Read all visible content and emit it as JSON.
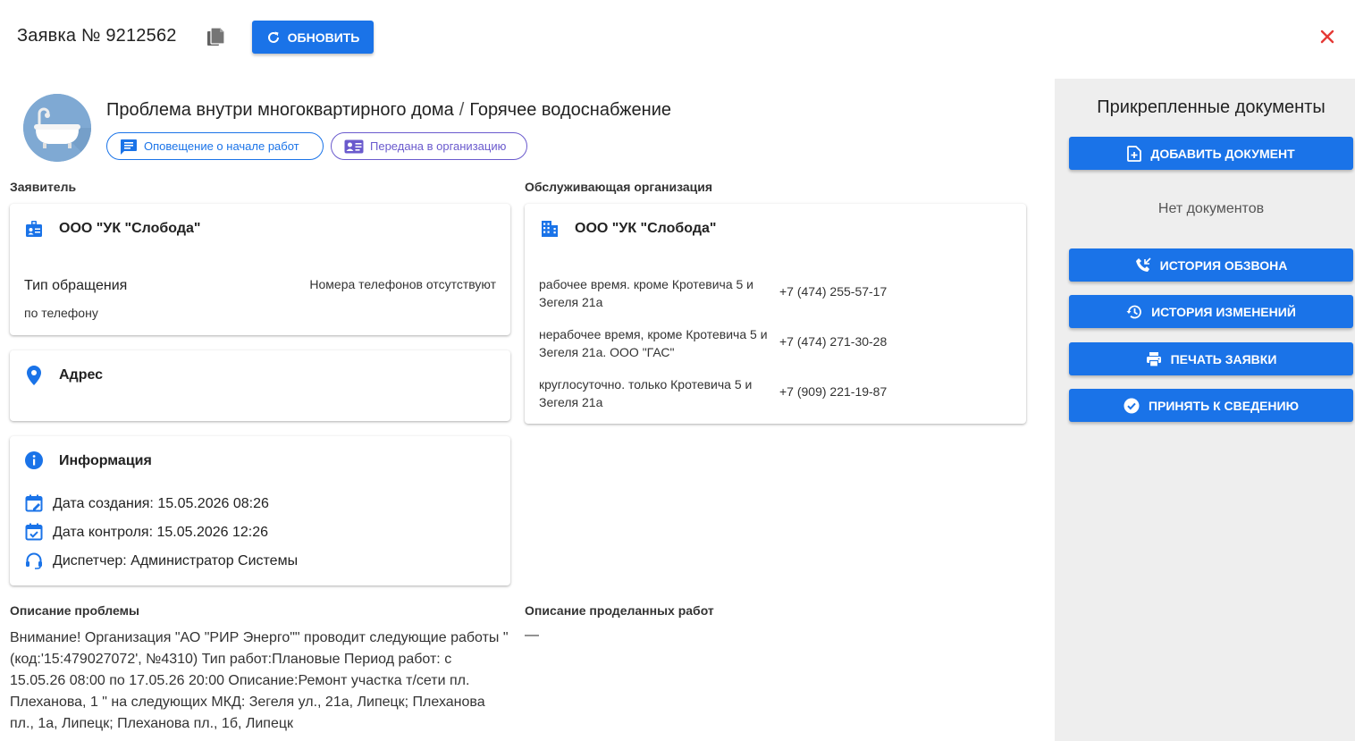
{
  "header": {
    "ticket_title": "Заявка № 9212562",
    "refresh_label": "ОБНОВИТЬ"
  },
  "problem": {
    "category": "Проблема внутри многоквартирного дома",
    "separator": "/",
    "subcategory": "Горячее водоснабжение",
    "chips": [
      {
        "label": "Оповещение о начале работ",
        "icon": "message-icon"
      },
      {
        "label": "Передана в организацию",
        "icon": "contact-card-icon"
      }
    ]
  },
  "applicant": {
    "section_label": "Заявитель",
    "name": "ООО \"УК \"Слобода\"",
    "request_type_label": "Тип обращения",
    "request_type_value": "по телефону",
    "phones_note": "Номера телефонов отсутствуют"
  },
  "address": {
    "title": "Адрес"
  },
  "info": {
    "title": "Информация",
    "created": "Дата создания: 15.05.2026 08:26",
    "control": "Дата контроля: 15.05.2026 12:26",
    "dispatcher": "Диспетчер: Администратор Системы"
  },
  "service_org": {
    "section_label": "Обслуживающая организация",
    "name": "ООО \"УК \"Слобода\"",
    "phones": [
      {
        "desc": "рабочее время. кроме Кротевича 5 и Зегеля 21а",
        "number": "+7 (474) 255-57-17"
      },
      {
        "desc": "нерабочее время, кроме Кротевича 5 и Зегеля 21а. ООО \"ГАС\"",
        "number": "+7 (474) 271-30-28"
      },
      {
        "desc": "круглосуточно. только Кротевича 5 и Зегеля 21а",
        "number": "+7 (909) 221-19-87"
      }
    ]
  },
  "description": {
    "label": "Описание проблемы",
    "text": "Внимание! Организация \"АО \"РИР Энерго\"\" проводит следующие работы \"(код:'15:479027072', №4310) Тип работ:Плановые Период работ: с 15.05.26 08:00 по 17.05.26 20:00 Описание:Ремонт участка т/сети пл. Плеханова, 1 \" на следующих МКД: Зегеля ул., 21а, Липецк; Плеханова пл., 1а, Липецк; Плеханова пл., 1б, Липецк"
  },
  "work_done": {
    "label": "Описание проделанных работ",
    "text": "—"
  },
  "sidebar": {
    "title": "Прикрепленные документы",
    "add_doc": "ДОБАВИТЬ ДОКУМЕНТ",
    "no_docs": "Нет документов",
    "call_history": "ИСТОРИЯ ОБЗВОНА",
    "change_history": "ИСТОРИЯ ИЗМЕНЕНИЙ",
    "print": "ПЕЧАТЬ ЗАЯВКИ",
    "acknowledge": "ПРИНЯТЬ К СВЕДЕНИЮ"
  },
  "colors": {
    "accent": "#1a73e8",
    "close": "#e53935",
    "sidebar_bg": "#eeeeee",
    "chip_purple": "#6a5acd"
  }
}
